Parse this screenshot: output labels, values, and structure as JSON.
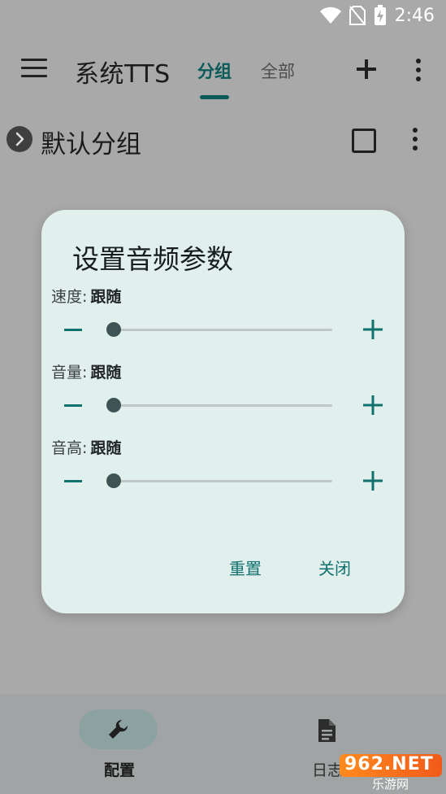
{
  "status_bar": {
    "time": "2:46"
  },
  "app_bar": {
    "title": "系统TTS",
    "tabs": [
      {
        "label": "分组",
        "selected": true
      },
      {
        "label": "全部",
        "selected": false
      }
    ],
    "add_icon": "add-icon",
    "more_icon": "more-vert-icon"
  },
  "group": {
    "title": "默认分组",
    "expand_icon": "chevron-right-icon"
  },
  "dialog": {
    "title": "设置音频参数",
    "params": [
      {
        "label": "速度:",
        "value": "跟随",
        "level": 0
      },
      {
        "label": "音量:",
        "value": "跟随",
        "level": 0
      },
      {
        "label": "音高:",
        "value": "跟随",
        "level": 0
      }
    ],
    "reset_label": "重置",
    "close_label": "关闭"
  },
  "bottom_nav": {
    "items": [
      {
        "label": "配置",
        "icon": "wrench-icon",
        "selected": true
      },
      {
        "label": "日志",
        "icon": "document-icon",
        "selected": false
      }
    ]
  },
  "watermark": {
    "text": "962.NET",
    "subtext": "乐游网"
  },
  "colors": {
    "accent": "#0a5a5a",
    "dialog_bg": "#e1efed",
    "button_text": "#10716e",
    "scrim": "#a9a9a9"
  }
}
